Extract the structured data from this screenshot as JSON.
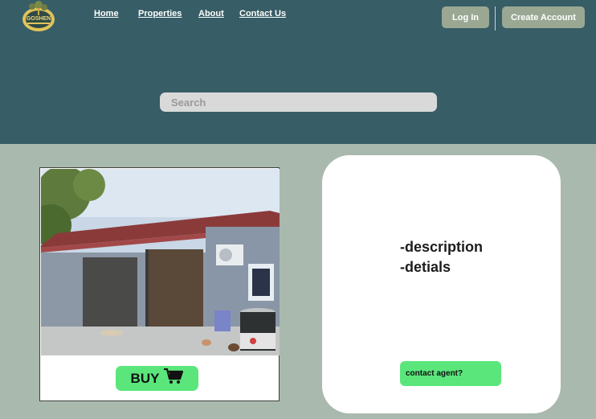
{
  "nav": {
    "links": [
      "Home",
      "Properties",
      "About",
      "Contact Us"
    ],
    "login_label": "Log In",
    "create_account_label": "Create Account"
  },
  "logo": {
    "text": "GOSHEN"
  },
  "search": {
    "placeholder": "Search"
  },
  "listing": {
    "buy_label": "BUY",
    "buy_icon": "cart-icon",
    "description_lines": [
      "-description",
      "-detials"
    ],
    "contact_label": "contact agent?"
  },
  "colors": {
    "header": "#375d66",
    "page_bg": "#a9b9ae",
    "accent_green": "#5ae67b",
    "button_bg": "#9aa893"
  }
}
